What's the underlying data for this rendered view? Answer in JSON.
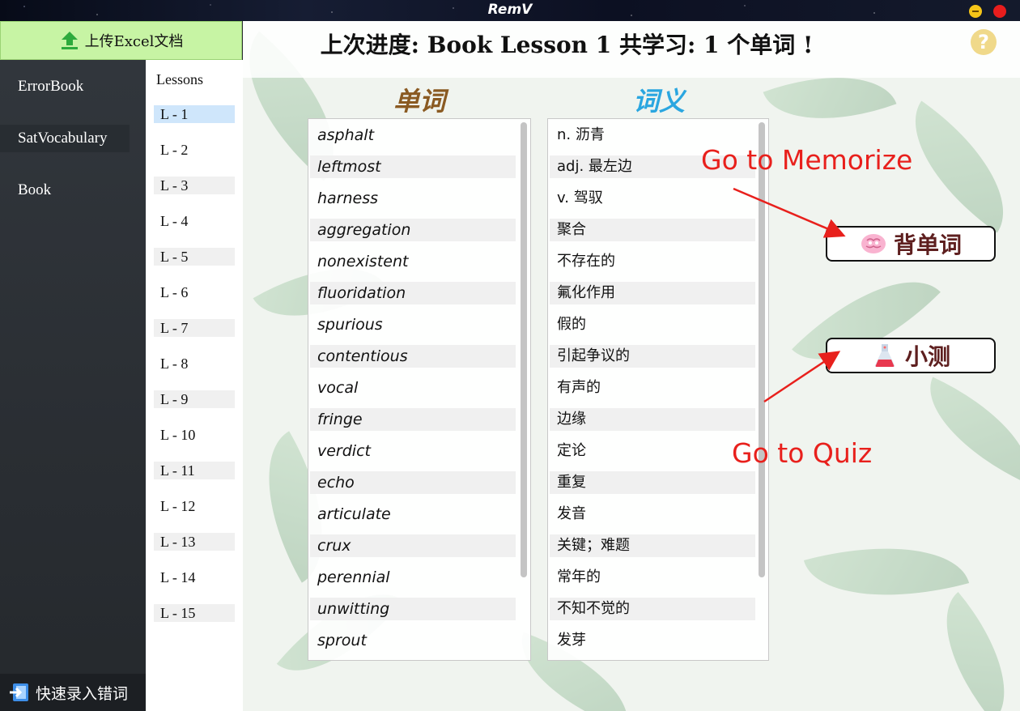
{
  "window": {
    "title": "RemV"
  },
  "sidebar": {
    "upload_label": "上传Excel文档",
    "categories": [
      {
        "label": "ErrorBook"
      },
      {
        "label": "SatVocabulary"
      },
      {
        "label": "Book"
      }
    ],
    "quick_add_label": "快速录入错词"
  },
  "lessons": {
    "header": "Lessons",
    "items": [
      "L - 1",
      "L - 2",
      "L - 3",
      "L - 4",
      "L - 5",
      "L - 6",
      "L - 7",
      "L - 8",
      "L - 9",
      "L - 10",
      "L - 11",
      "L - 12",
      "L - 13",
      "L - 14",
      "L - 15"
    ],
    "selected": "L - 1"
  },
  "main": {
    "headline": "上次进度: Book Lesson 1  共学习: 1 个单词 !",
    "help_icon": "?",
    "word_column_title": "单词",
    "meaning_column_title": "词义",
    "words": [
      "asphalt",
      "leftmost",
      "harness",
      "aggregation",
      "nonexistent",
      "fluoridation",
      "spurious",
      "contentious",
      "vocal",
      "fringe",
      "verdict",
      "echo",
      "articulate",
      "crux",
      "perennial",
      "unwitting",
      "sprout"
    ],
    "meanings": [
      "n.  沥青",
      "adj.  最左边",
      "v.  驾驭",
      "聚合",
      "不存在的",
      "氟化作用",
      "假的",
      "引起争议的",
      "有声的",
      "边缘",
      "定论",
      "重复",
      "发音",
      "关键；难题",
      "常年的",
      "不知不觉的",
      "发芽"
    ],
    "memorize_button": "背单词",
    "quiz_button": "小测",
    "annotation_memorize": "Go to Memorize",
    "annotation_quiz": "Go to Quiz"
  },
  "colors": {
    "upload_bg": "#c7f4a4",
    "selected_lesson": "#cfe6fb",
    "word_title": "#8a5a22",
    "meaning_title": "#2aa6e0",
    "annotation": "#e8201c",
    "button_text": "#5e1f1f"
  },
  "icons": {
    "upload": "upload-arrow-icon",
    "quick_add": "login-arrow-icon",
    "memorize": "brain-icon",
    "quiz": "flask-icon",
    "help": "question-icon"
  }
}
